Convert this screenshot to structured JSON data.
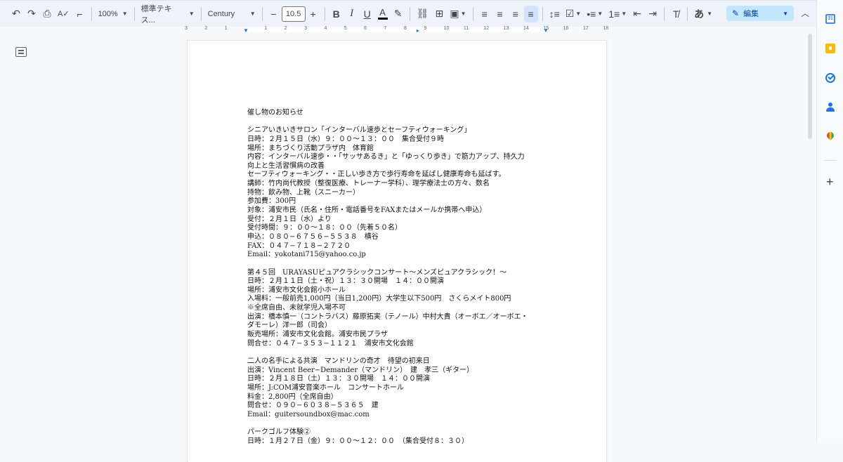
{
  "toolbar": {
    "zoom": "100%",
    "style": "標準テキス...",
    "font": "Century",
    "font_size": "10.5",
    "bold": "B",
    "italic": "I",
    "underline": "U",
    "text_color": "A",
    "input_tools": "あ",
    "mode": "編集"
  },
  "ruler": {
    "numbers": [
      "3",
      "2",
      "1",
      "1",
      "2",
      "3",
      "4",
      "5",
      "6",
      "7",
      "8",
      "9",
      "10",
      "11",
      "12",
      "13",
      "14",
      "15",
      "16",
      "17",
      "18"
    ]
  },
  "side_panel": {
    "calendar_label": "31"
  },
  "document": {
    "lines": [
      "催し物のお知らせ",
      "",
      "シニアいきいきサロン「インターバル速歩とセーフティウォーキング」",
      "日時：２月１５日（水）９：００～１３：００　集合受付９時",
      "場所：まちづくり活動プラザ内　体育館",
      "内容：インターバル速歩・・「サッサあるき」と「ゆっくり歩き」で筋力アップ、持久力",
      "向上と生活習慣病の改善",
      "セーフティウォーキング・・正しい歩き方で歩行寿命を延ばし健康寿命も延ばす。",
      "講師：竹内尚代教授（整復医療、トレーナー学科）、理学療法士の方々、数名",
      "持物：飲み物、上靴（スニーカー）",
      "参加費：300円",
      "対象：浦安市民（氏名・住所・電話番号をFAXまたはメールか携帯へ申込）",
      "受付：２月１日（水）より",
      "受付時間：９：００～１８：００（先着５０名）",
      "申込：０８０−６７５６−５５３８　横谷",
      "FAX：０４７−７１８−２７２０",
      "Email：yokotani715@yahoo.co.jp",
      "",
      "第４５回　URAYASUピュアクラシックコンサート～メンズピュアクラシック！～",
      "日時：２月１１日（土・祝）１３：３０開場　１４：００開演",
      "場所：浦安市文化会館小ホール",
      "入場料：一般前売1,000円（当日1,200円）大学生以下500円　さくらメイト800円",
      "※全席自由、未就学児入場不可",
      "出演：橋本慎一（コントラバス）藤原拓実（テノール）中村大貴（オーボエ／オーボエ・",
      "ダモーレ）洋一郎（司会）",
      "販売場所：浦安市文化会館。浦安市民プラザ",
      "問合せ：０４７−３５３−１１２１　浦安市文化会館",
      "",
      "二人の名手による共演　マンドリンの奇才　待望の初来日",
      "出演：Vincent Beer−Demander（マンドリン）　建　孝三（ギター）",
      "日時：２月１８日（土）１３：３０開場　１４：００開演",
      "場所：J:COM浦安音楽ホール　コンサートホール",
      "料金：2,800円（全席自由）",
      "問合せ：０９０−６０３８−５３６５　建",
      "Email：guitersoundbox@mac.com",
      "",
      "パークゴルフ体験②",
      "日時：１月２７日（金）９：００～１２：００　（集合受付８：３０）"
    ]
  }
}
